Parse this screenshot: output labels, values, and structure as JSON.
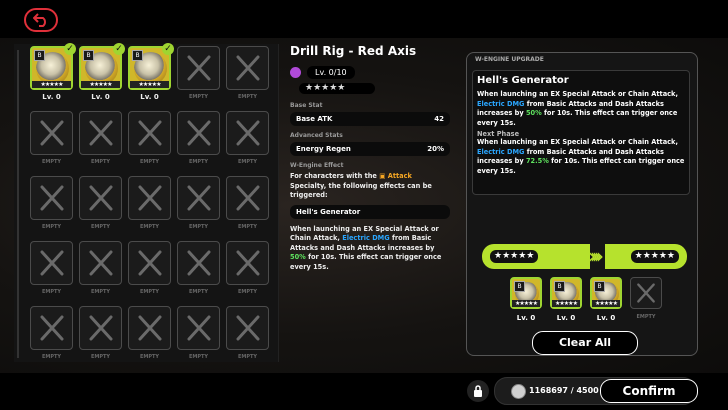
{
  "engine": {
    "name": "Drill Rig - Red Axis",
    "level": "Lv. 0/10",
    "stars": "★★★★★",
    "base_stat_header": "Base Stat",
    "base_stat_name": "Base ATK",
    "base_stat_value": "42",
    "adv_stat_header": "Advanced Stats",
    "adv_stat_name": "Energy Regen",
    "adv_stat_value": "20%",
    "effect_header": "W-Engine Effect",
    "effect_intro_1": "For characters with the",
    "effect_intro_specialty": "Attack",
    "effect_intro_2": "Specialty, the following effects can be triggered:",
    "effect_name": "Hell's Generator",
    "effect_p1": "When launching an EX Special Attack or Chain Attack, ",
    "effect_electric": "Electric DMG",
    "effect_p2": " from Basic Attacks and Dash Attacks increases by ",
    "effect_value": "50%",
    "effect_p3": " for 10s. This effect can trigger once every 15s."
  },
  "grid": {
    "items": [
      {
        "label": "Lv. 0",
        "filled": true
      },
      {
        "label": "Lv. 0",
        "filled": true
      },
      {
        "label": "Lv. 0",
        "filled": true
      },
      {
        "label": "EMPTY",
        "filled": false
      },
      {
        "label": "EMPTY",
        "filled": false
      },
      {
        "label": "EMPTY",
        "filled": false
      },
      {
        "label": "EMPTY",
        "filled": false
      },
      {
        "label": "EMPTY",
        "filled": false
      },
      {
        "label": "EMPTY",
        "filled": false
      },
      {
        "label": "EMPTY",
        "filled": false
      },
      {
        "label": "EMPTY",
        "filled": false
      },
      {
        "label": "EMPTY",
        "filled": false
      },
      {
        "label": "EMPTY",
        "filled": false
      },
      {
        "label": "EMPTY",
        "filled": false
      },
      {
        "label": "EMPTY",
        "filled": false
      },
      {
        "label": "EMPTY",
        "filled": false
      },
      {
        "label": "EMPTY",
        "filled": false
      },
      {
        "label": "EMPTY",
        "filled": false
      },
      {
        "label": "EMPTY",
        "filled": false
      },
      {
        "label": "EMPTY",
        "filled": false
      },
      {
        "label": "EMPTY",
        "filled": false
      },
      {
        "label": "EMPTY",
        "filled": false
      },
      {
        "label": "EMPTY",
        "filled": false
      },
      {
        "label": "EMPTY",
        "filled": false
      },
      {
        "label": "EMPTY",
        "filled": false
      }
    ]
  },
  "upgrade": {
    "header": "W-ENGINE UPGRADE",
    "title": "Hell's Generator",
    "p1": "When launching an EX Special Attack or Chain Attack, ",
    "electric": "Electric DMG",
    "p2": " from Basic Attacks and Dash Attacks increases by ",
    "value_now": "50%",
    "p3": " for 10s. This effect can trigger once every 15s.",
    "next_phase": "Next Phase",
    "value_next": "72.5%",
    "rank_from": "★★★★★",
    "rank_to": "★★★★★",
    "materials": [
      {
        "label": "Lv. 0",
        "filled": true
      },
      {
        "label": "Lv. 0",
        "filled": true
      },
      {
        "label": "Lv. 0",
        "filled": true
      },
      {
        "label": "EMPTY",
        "filled": false
      }
    ],
    "clear_all": "Clear All"
  },
  "footer": {
    "currency": "1168697 / 4500",
    "confirm": "Confirm"
  },
  "colors": {
    "accent_green": "#9fd531",
    "electric_blue": "#2aa6ff",
    "bonus_green": "#5fe35f",
    "back_red": "#e0303a"
  },
  "icons": {
    "back": "back-arrow-icon",
    "lock": "lock-icon",
    "coin": "denny-coin-icon"
  }
}
